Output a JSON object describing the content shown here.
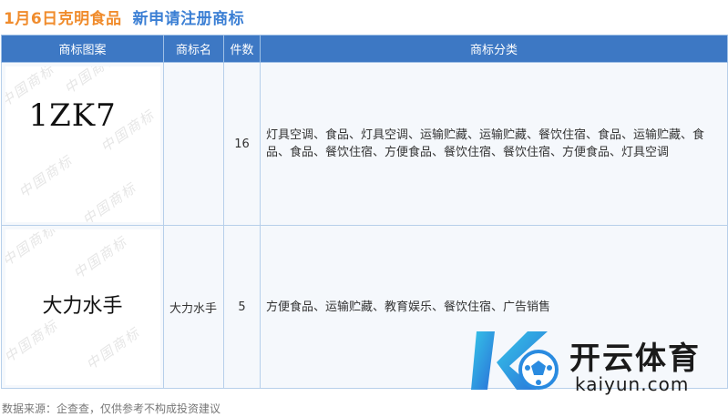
{
  "header": {
    "company": "1月6日克明食品",
    "subject": "新申请注册商标"
  },
  "table": {
    "columns": [
      "商标图案",
      "商标名",
      "件数",
      "商标分类"
    ],
    "rows": [
      {
        "mark_text": "1ZK7",
        "name": "",
        "count": "16",
        "classes": "灯具空调、食品、灯具空调、运输贮藏、运输贮藏、餐饮住宿、食品、运输贮藏、食品、食品、餐饮住宿、方便食品、餐饮住宿、餐饮住宿、方便食品、灯具空调"
      },
      {
        "mark_text": "大力水手",
        "name": "大力水手",
        "count": "5",
        "classes": "方便食品、运输贮藏、教育娱乐、餐饮住宿、广告销售"
      }
    ]
  },
  "watermark": "中国商标",
  "footer": "数据来源：企查查，仅供参考不构成投资建议",
  "logo": {
    "cn": "开云体育",
    "en": "kaiyun.com",
    "colors": {
      "blue": "#2a8be0",
      "cyan": "#35c6e8"
    }
  }
}
